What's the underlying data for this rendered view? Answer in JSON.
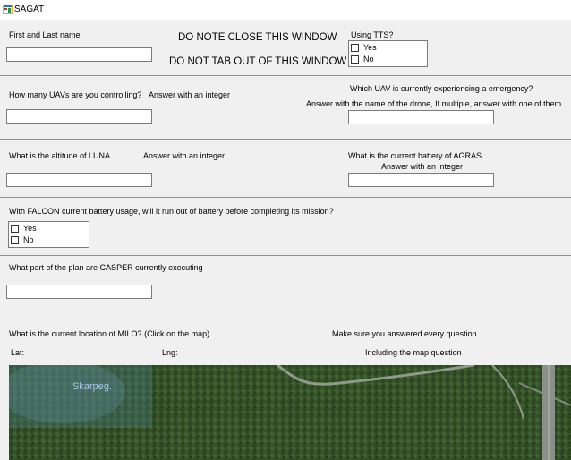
{
  "window": {
    "title": "SAGAT"
  },
  "form": {
    "name_label": "First and Last name",
    "warning_close": "DO NOTE CLOSE THIS WINDOW",
    "warning_tab": "DO NOT TAB OUT OF THIS WINDOW",
    "tts": {
      "label": "Using TTS?",
      "options": [
        "Yes",
        "No"
      ]
    },
    "uav_count": {
      "question": "How many UAVs are you controlling?",
      "hint": "Answer with an integer"
    },
    "emergency": {
      "question": "Which UAV is currently experiencing a emergency?",
      "hint": "Answer with the name of the drone, If multiple, answer with one of them"
    },
    "altitude": {
      "question": "What is the altitude of LUNA",
      "hint": "Answer with an integer"
    },
    "battery": {
      "question": "What is the current battery of AGRAS",
      "hint": "Answer with an integer"
    },
    "falcon": {
      "question": "With FALCON current battery usage, will it run out of battery before completing its mission?",
      "options": [
        "Yes",
        "No"
      ]
    },
    "casper": {
      "question": "What part of the plan are CASPER currently executing"
    },
    "location": {
      "question": "What is the current location of MILO? (Click on the map)",
      "lat_label": "Lat:",
      "lng_label": "Lng:"
    },
    "reminder": {
      "line1": "Make sure you answered every question",
      "line2": "Including the map question"
    }
  },
  "map": {
    "place_label": "Skarpeg."
  }
}
